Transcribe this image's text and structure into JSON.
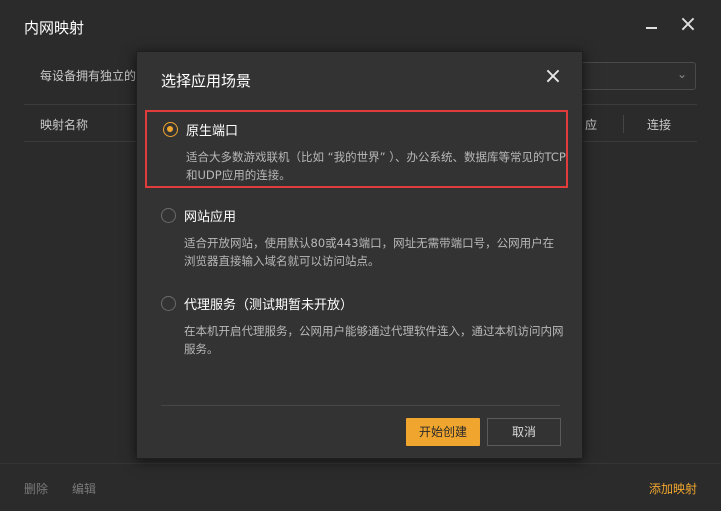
{
  "window": {
    "title": "内网映射",
    "minimize_icon": "minimize-icon",
    "close_icon": "close-icon",
    "close_glyph": "×"
  },
  "device": {
    "label": "每设备拥有独立的",
    "select_icon": "chevron-down-icon",
    "chevron_glyph": "⌄"
  },
  "table": {
    "headers": {
      "name": "映射名称",
      "app": "应",
      "connect": "连接"
    }
  },
  "footer": {
    "delete_label": "删除",
    "edit_label": "编辑",
    "add_label": "添加映射"
  },
  "modal": {
    "title": "选择应用场景",
    "close_glyph": "×",
    "options": [
      {
        "label": "原生端口",
        "description": "适合大多数游戏联机（比如 “我的世界” ）、办公系统、数据库等常见的TCP和UDP应用的连接。",
        "selected": true
      },
      {
        "label": "网站应用",
        "description": "适合开放网站，使用默认80或443端口，网址无需带端口号，公网用户在浏览器直接输入域名就可以访问站点。",
        "selected": false
      },
      {
        "label": "代理服务（测试期暂未开放）",
        "description": "在本机开启代理服务，公网用户能够通过代理软件连入，通过本机访问内网服务。",
        "selected": false
      }
    ],
    "create_label": "开始创建",
    "cancel_label": "取消"
  },
  "colors": {
    "accent": "#f0a62e",
    "highlight_border": "#e03c3c",
    "background": "#2b2b2b",
    "modal_background": "#333333"
  }
}
